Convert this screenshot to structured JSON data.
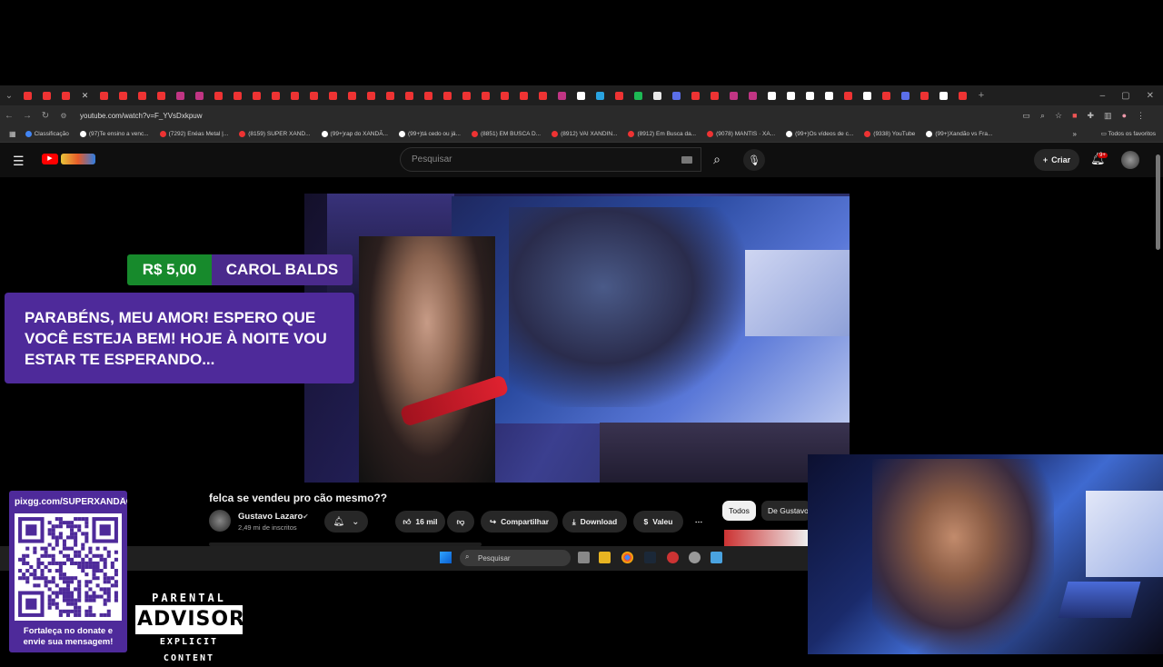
{
  "browser": {
    "url": "youtube.com/watch?v=F_YVsDxkpuw",
    "tab_icon_colors": [
      "#e33",
      "#e33",
      "#e33",
      "#e33",
      "#e33",
      "#e33",
      "#e33",
      "#c13584",
      "#c13584",
      "#e33",
      "#e33",
      "#e33",
      "#e33",
      "#e33",
      "#e33",
      "#e33",
      "#e33",
      "#e33",
      "#e33",
      "#e33",
      "#e33",
      "#e33",
      "#e33",
      "#e33",
      "#e33",
      "#e33",
      "#e33",
      "#c13584",
      "#fff",
      "#29a3e0",
      "#e33",
      "#1db954",
      "#e8e8e8",
      "#5b6fe8",
      "#e33",
      "#e33",
      "#c13584",
      "#c13584",
      "#fff",
      "#fff",
      "#fff",
      "#fff",
      "#e33",
      "#fff",
      "#e33",
      "#5b6fe8",
      "#e33",
      "#fff",
      "#e33"
    ],
    "bookmarks": [
      {
        "label": "Classificação",
        "color": "#4285f4"
      },
      {
        "label": "(97)Te ensino a venc...",
        "color": "#fff"
      },
      {
        "label": "(7292) Enéas Metal |...",
        "color": "#e33"
      },
      {
        "label": "(8159) SUPER XAND...",
        "color": "#e33"
      },
      {
        "label": "(99+)rap do XANDÃ...",
        "color": "#fff"
      },
      {
        "label": "(99+)tá cedo ou já...",
        "color": "#fff"
      },
      {
        "label": "(8851) EM BUSCA D...",
        "color": "#e33"
      },
      {
        "label": "(8912) VAI XANDIN...",
        "color": "#e33"
      },
      {
        "label": "(8912) Em Busca da...",
        "color": "#e33"
      },
      {
        "label": "(9078) MANTIS · XA...",
        "color": "#e33"
      },
      {
        "label": "(99+)Os vídeos de c...",
        "color": "#fff"
      },
      {
        "label": "(9338) YouTube",
        "color": "#e33"
      },
      {
        "label": "(99+)Xandão vs Fra...",
        "color": "#fff"
      }
    ],
    "all_favorites": "Todos os favoritos"
  },
  "youtube": {
    "search_placeholder": "Pesquisar",
    "create_label": "Criar",
    "notif_count": "9+",
    "video_title": "felca se vendeu pro cão mesmo??",
    "channel_name": "Gustavo Lazaro",
    "channel_subs": "2,49 mi de inscritos",
    "likes": "16 mil",
    "share_label": "Compartilhar",
    "download_label": "Download",
    "valeu_label": "Valeu",
    "chip_all": "Todos",
    "chip_channel": "De Gustavo"
  },
  "superchat": {
    "amount": "R$ 5,00",
    "name": "CAROL BALDS",
    "message": "PARABÉNS, MEU AMOR! ESPERO QUE VOCÊ ESTEJA BEM! HOJE À NOITE VOU ESTAR TE ESPERANDO..."
  },
  "taskbar": {
    "search_placeholder": "Pesquisar"
  },
  "qr_overlay": {
    "url": "pixgg.com/SUPERXANDÃO",
    "text": "Fortaleça no donate e envie sua mensagem!"
  },
  "parental_advisory": {
    "top": "PARENTAL",
    "middle": "ADVISORY",
    "bottom": "EXPLICIT CONTENT"
  }
}
